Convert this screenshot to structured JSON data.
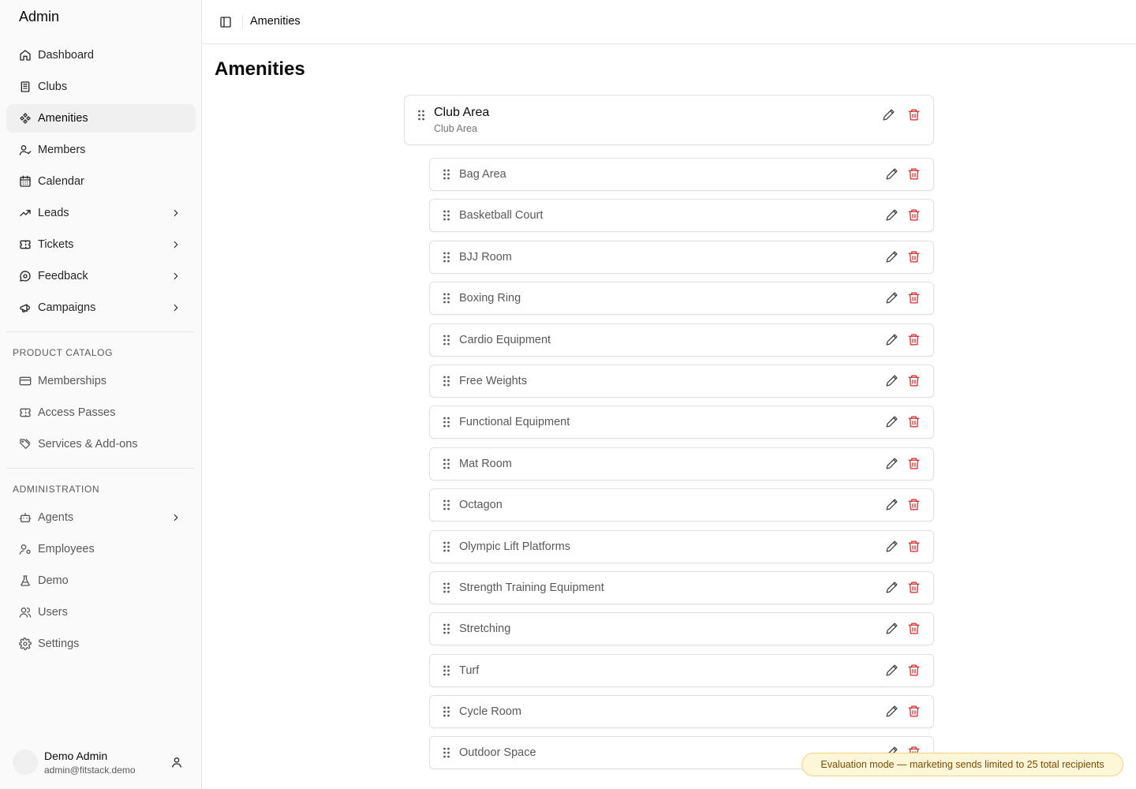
{
  "sidebar": {
    "brand": "Admin",
    "main_items": [
      {
        "label": "Dashboard",
        "icon": "home-icon",
        "active": false,
        "chevron": false
      },
      {
        "label": "Clubs",
        "icon": "building-icon",
        "active": false,
        "chevron": false
      },
      {
        "label": "Amenities",
        "icon": "amenities-icon",
        "active": true,
        "chevron": false
      },
      {
        "label": "Members",
        "icon": "user-check-icon",
        "active": false,
        "chevron": false
      },
      {
        "label": "Calendar",
        "icon": "calendar-icon",
        "active": false,
        "chevron": false
      },
      {
        "label": "Leads",
        "icon": "trending-up-icon",
        "active": false,
        "chevron": true
      },
      {
        "label": "Tickets",
        "icon": "ticket-icon",
        "active": false,
        "chevron": true
      },
      {
        "label": "Feedback",
        "icon": "message-icon",
        "active": false,
        "chevron": true
      },
      {
        "label": "Campaigns",
        "icon": "megaphone-icon",
        "active": false,
        "chevron": true
      }
    ],
    "catalog_label": "PRODUCT CATALOG",
    "catalog_items": [
      {
        "label": "Memberships",
        "icon": "credit-card-icon"
      },
      {
        "label": "Access Passes",
        "icon": "ticket-icon"
      },
      {
        "label": "Services & Add-ons",
        "icon": "tags-icon"
      }
    ],
    "admin_label": "ADMINISTRATION",
    "admin_items": [
      {
        "label": "Agents",
        "icon": "bot-icon",
        "chevron": true
      },
      {
        "label": "Employees",
        "icon": "user-cog-icon",
        "chevron": false
      },
      {
        "label": "Demo",
        "icon": "flask-icon",
        "chevron": false
      },
      {
        "label": "Users",
        "icon": "users-icon",
        "chevron": false
      },
      {
        "label": "Settings",
        "icon": "gear-icon",
        "chevron": false
      }
    ],
    "user": {
      "name": "Demo Admin",
      "email": "admin@fitstack.demo"
    }
  },
  "header": {
    "title": "Amenities"
  },
  "page": {
    "title": "Amenities"
  },
  "parent": {
    "title": "Club Area",
    "subtitle": "Club Area"
  },
  "children": [
    "Bag Area",
    "Basketball Court",
    "BJJ Room",
    "Boxing Ring",
    "Cardio Equipment",
    "Free Weights",
    "Functional Equipment",
    "Mat Room",
    "Octagon",
    "Olympic Lift Platforms",
    "Strength Training Equipment",
    "Stretching",
    "Turf",
    "Cycle Room",
    "Outdoor Space"
  ],
  "toast": "Evaluation mode — marketing sends limited to 25 total recipients",
  "colors": {
    "delete": "#dc2626",
    "edit": "#404040",
    "accent_bg": "#fdf6d8"
  }
}
